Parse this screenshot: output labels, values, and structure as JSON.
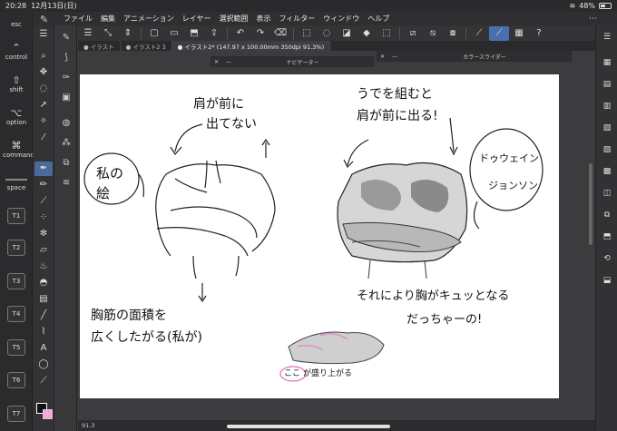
{
  "statusbar": {
    "time": "20:28",
    "date": "12月13日(日)",
    "battery": "48%",
    "battery_fill": 0.48
  },
  "menubar": {
    "items": [
      "ファイル",
      "編集",
      "アニメーション",
      "レイヤー",
      "選択範囲",
      "表示",
      "フィルター",
      "ウィンドウ",
      "ヘルプ"
    ]
  },
  "keys": {
    "esc": "esc",
    "control": "control",
    "shift": "shift",
    "option": "option",
    "command": "command",
    "space": "space",
    "t1": "T1",
    "t2": "T2",
    "t3": "T3",
    "t4": "T4",
    "t5": "T5",
    "t6": "T6",
    "t7": "T7"
  },
  "tabs": [
    "イラスト",
    "イラスト2 3",
    "イラスト2* (147.97 x 100.00mm 350dpi 91.3%)"
  ],
  "panels": {
    "navigator": "ナビゲーター",
    "color_slider": "カラースライダー"
  },
  "canvas_text": {
    "left_circle": [
      "私の",
      "絵"
    ],
    "top_left": [
      "肩が前に",
      "出てない"
    ],
    "top_right": [
      "うでを組むと",
      "肩が前に出る!"
    ],
    "right_circle": [
      "ドゥウェイン",
      "ジョンソン"
    ],
    "bottom_left": [
      "胸筋の面積を",
      "広くしたがる(私が)"
    ],
    "bottom_right": [
      "それにより胸がキュッとなる",
      "だっちゃーの!"
    ],
    "small_label": [
      "ここ",
      "が盛り上がる"
    ]
  },
  "bottombar": {
    "zoom": "91.3"
  },
  "colors": {
    "main": "#111111",
    "sub": "#f4a7d8",
    "accent": "#4a6fae"
  }
}
